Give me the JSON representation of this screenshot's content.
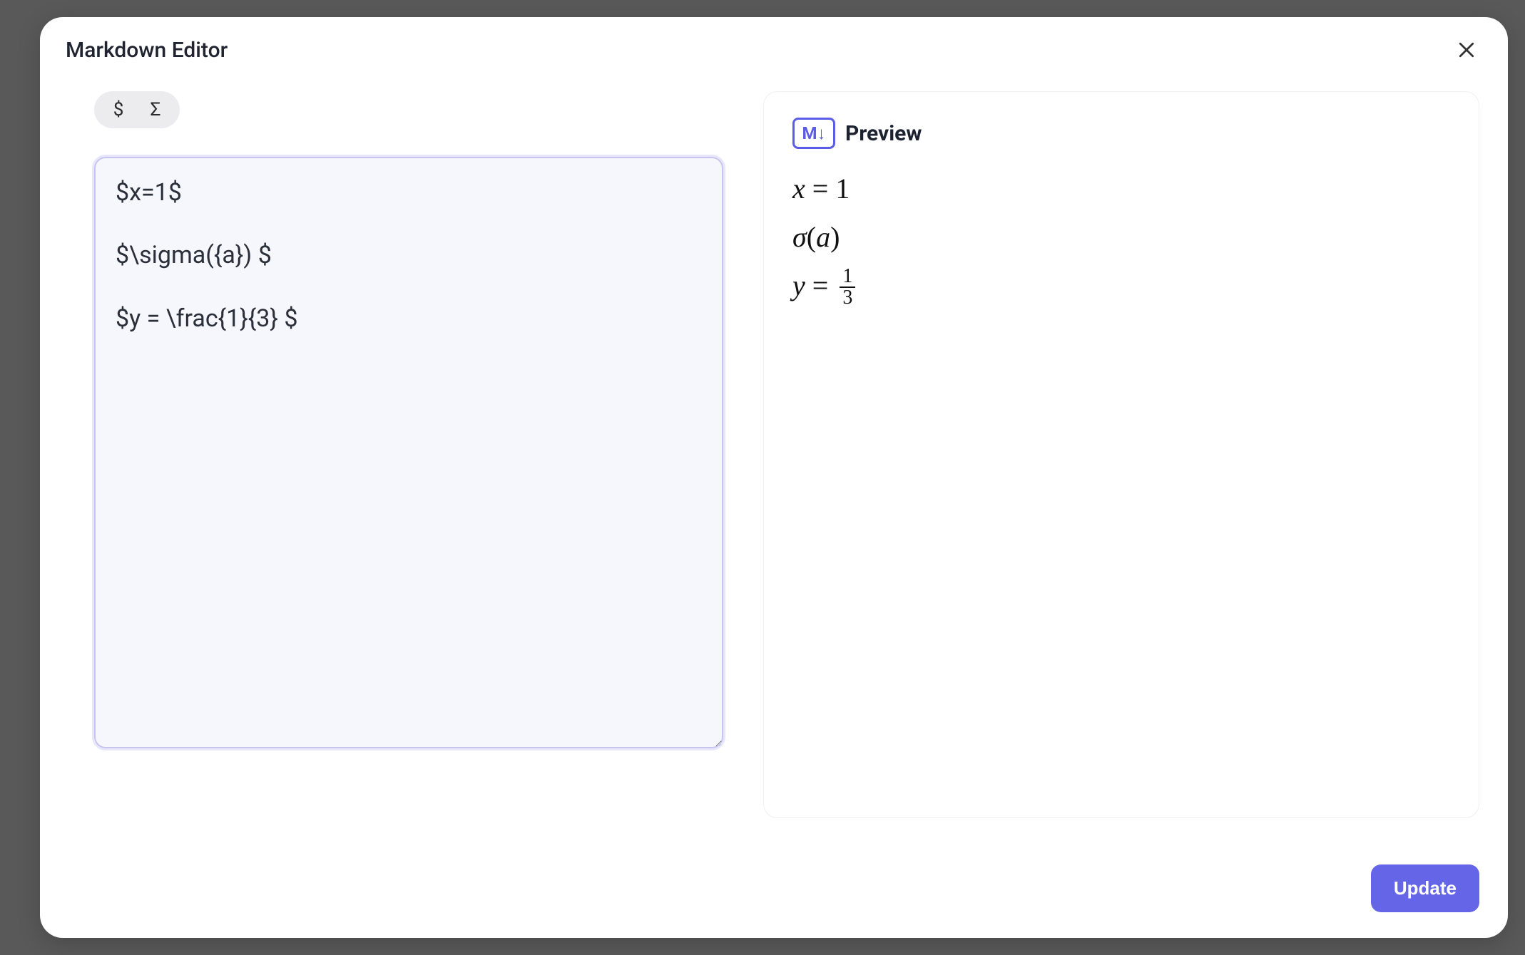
{
  "modal": {
    "title": "Markdown Editor",
    "close_aria": "Close"
  },
  "toolbar": {
    "dollar_label": "$",
    "sigma_label": "Σ"
  },
  "editor": {
    "value": "$x=1$\n\n$\\sigma({a}) $\n\n$y = \\frac{1}{3} $"
  },
  "preview": {
    "icon_text": "M↓",
    "title": "Preview",
    "line1_lhs": "x",
    "line1_eq": "=",
    "line1_rhs": "1",
    "line2_sigma": "σ",
    "line2_arg": "a",
    "line3_lhs": "y",
    "line3_eq": "=",
    "line3_num": "1",
    "line3_den": "3"
  },
  "footer": {
    "update_label": "Update"
  }
}
